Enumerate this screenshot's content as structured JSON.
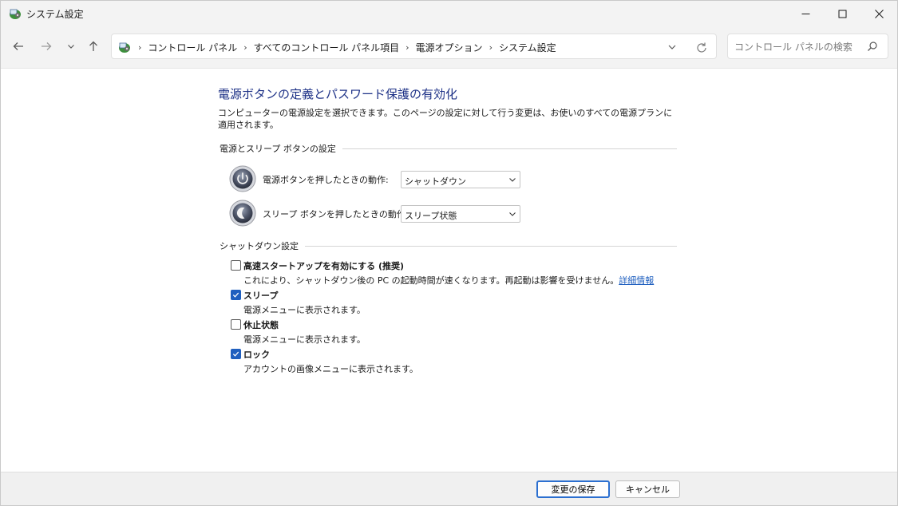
{
  "window": {
    "title": "システム設定"
  },
  "nav": {
    "breadcrumbs": [
      "コントロール パネル",
      "すべてのコントロール パネル項目",
      "電源オプション",
      "システム設定"
    ],
    "search_placeholder": "コントロール パネルの検索"
  },
  "page": {
    "title": "電源ボタンの定義とパスワード保護の有効化",
    "description": "コンピューターの電源設定を選択できます。このページの設定に対して行う変更は、お使いのすべての電源プランに適用されます。"
  },
  "power_buttons": {
    "header": "電源とスリープ ボタンの設定",
    "rows": [
      {
        "label": "電源ボタンを押したときの動作:",
        "value": "シャットダウン"
      },
      {
        "label": "スリープ ボタンを押したときの動作:",
        "value": "スリープ状態"
      }
    ]
  },
  "shutdown": {
    "header": "シャットダウン設定",
    "options": [
      {
        "label": "高速スタートアップを有効にする (推奨)",
        "description": "これにより、シャットダウン後の PC の起動時間が速くなります。再起動は影響を受けません。",
        "link": "詳細情報",
        "checked": false
      },
      {
        "label": "スリープ",
        "description": "電源メニューに表示されます。",
        "checked": true
      },
      {
        "label": "休止状態",
        "description": "電源メニューに表示されます。",
        "checked": false
      },
      {
        "label": "ロック",
        "description": "アカウントの画像メニューに表示されます。",
        "checked": true
      }
    ]
  },
  "footer": {
    "save_label": "変更の保存",
    "cancel_label": "キャンセル"
  },
  "colors": {
    "title_blue": "#1e3287",
    "link_blue": "#1f5fbf",
    "checkbox_blue": "#1f5fbf"
  },
  "icons": [
    "control-panel-icon",
    "back-arrow-icon",
    "forward-arrow-icon",
    "chevron-down-icon",
    "up-arrow-icon",
    "refresh-icon",
    "search-icon",
    "power-icon",
    "sleep-icon",
    "checkmark-icon"
  ]
}
